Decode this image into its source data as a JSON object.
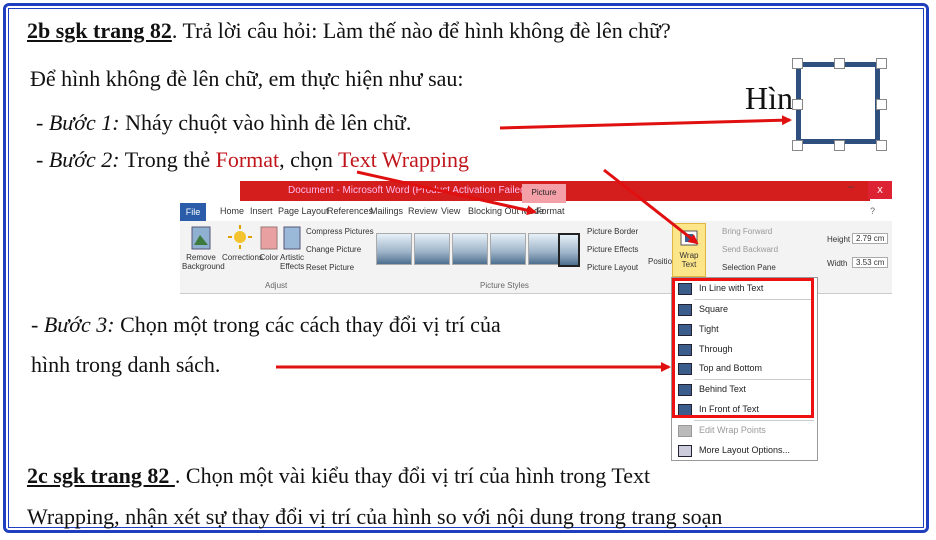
{
  "lines": {
    "q2b_ref": "2b sgk trang 82",
    "q2b_text": ". Trả lời câu hỏi: Làm thế nào để hình không đè lên chữ?",
    "intro": "Để hình không đè lên chữ, em thực hiện như sau:",
    "step1_label": "- Bước 1:",
    "step1_text": " Nháy chuột vào hình đè lên chữ.",
    "step2_label": "- Bước 2:",
    "step2_text": " Trong thẻ ",
    "step2_format": "Format",
    "step2_mid": ", chọn ",
    "step2_wrap": "Text Wrapping",
    "step3_label": "- Bước 3:",
    "step3_text": " Chọn một trong các cách thay đổi vị trí của",
    "step3_line2": "hình trong danh sách.",
    "q2c_ref": "2c sgk trang 82 ",
    "q2c_text": ". Chọn một vài kiểu thay đổi vị trí của hình trong Text",
    "q2c_line2": "Wrapping, nhận xét sự thay đổi vị trí của hình so với nội dung trong trang soạn"
  },
  "sample_text": "Hìn",
  "word": {
    "title": "Document - Microsoft Word (Product Activation Failed)",
    "picture_tools": "Picture Tools",
    "close": "x",
    "tabs": [
      "File",
      "Home",
      "Insert",
      "Page Layout",
      "References",
      "Mailings",
      "Review",
      "View",
      "Blocking Out Mode",
      "Format"
    ],
    "adjust": {
      "remove_bg": "Remove Background",
      "corrections": "Corrections",
      "color": "Color",
      "artistic": "Artistic Effects",
      "compress": "Compress Pictures",
      "change": "Change Picture",
      "reset": "Reset Picture",
      "group": "Adjust"
    },
    "styles_group": "Picture Styles",
    "border": "Picture Border",
    "effects": "Picture Effects",
    "layout": "Picture Layout",
    "position": "Position",
    "wrap_text": "Wrap Text",
    "bring_forward": "Bring Forward",
    "send_backward": "Send Backward",
    "selection_pane": "Selection Pane",
    "height_label": "Height",
    "height_value": "2.79 cm",
    "width_label": "Width",
    "width_value": "3.53 cm",
    "menu": [
      "In Line with Text",
      "Square",
      "Tight",
      "Through",
      "Top and Bottom",
      "Behind Text",
      "In Front of Text",
      "Edit Wrap Points",
      "More Layout Options..."
    ]
  },
  "colors": {
    "accent_red": "#c0161b",
    "frame_blue": "#1f3fbf",
    "arrow_red": "#e11010"
  }
}
